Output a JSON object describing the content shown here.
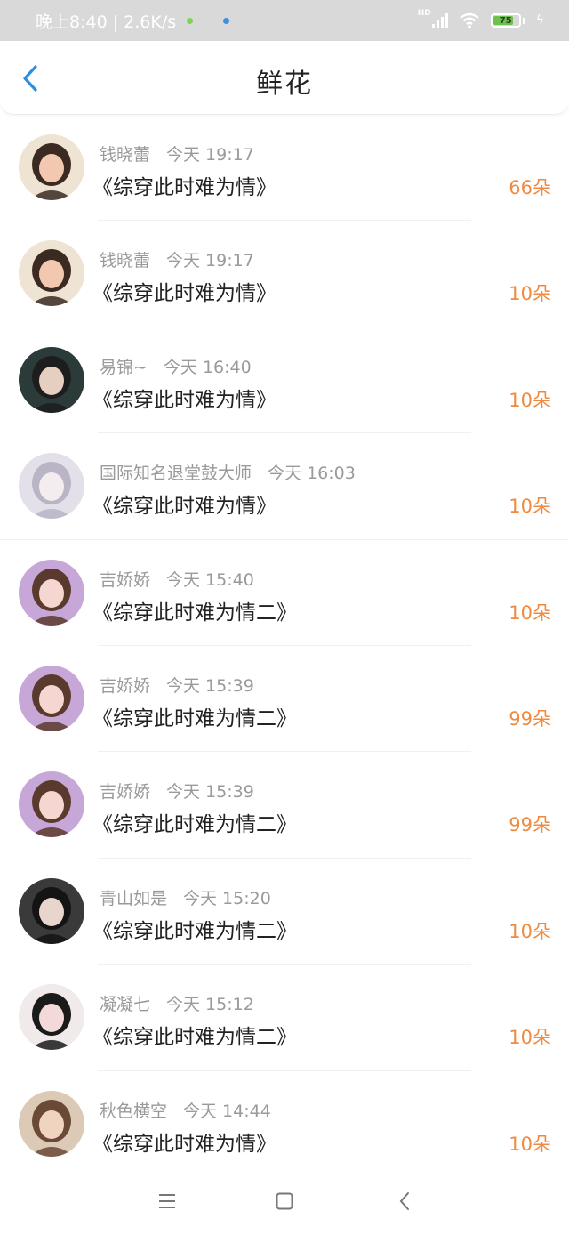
{
  "status_bar": {
    "time_speed": "晚上8:40 | 2.6K/s",
    "hd": "HD",
    "battery": "75",
    "dot_colors": [
      "#7bd35b",
      "#3d8fe0"
    ]
  },
  "nav": {
    "title": "鲜花",
    "back_icon": "chevron-left-icon"
  },
  "colors": {
    "accent": "#2a8de6",
    "count": "#f08a40"
  },
  "rows": [
    {
      "user": "钱晓蕾",
      "time": "今天 19:17",
      "book": "《综穿此时难为情》",
      "count": "66朵"
    },
    {
      "user": "钱晓蕾",
      "time": "今天 19:17",
      "book": "《综穿此时难为情》",
      "count": "10朵"
    },
    {
      "user": "易锦~",
      "time": "今天 16:40",
      "book": "《综穿此时难为情》",
      "count": "10朵"
    },
    {
      "user": "国际知名退堂鼓大师",
      "time": "今天 16:03",
      "book": "《综穿此时难为情》",
      "count": "10朵"
    },
    {
      "user": "吉娇娇",
      "time": "今天 15:40",
      "book": "《综穿此时难为情二》",
      "count": "10朵"
    },
    {
      "user": "吉娇娇",
      "time": "今天 15:39",
      "book": "《综穿此时难为情二》",
      "count": "99朵"
    },
    {
      "user": "吉娇娇",
      "time": "今天 15:39",
      "book": "《综穿此时难为情二》",
      "count": "99朵"
    },
    {
      "user": "青山如是",
      "time": "今天 15:20",
      "book": "《综穿此时难为情二》",
      "count": "10朵"
    },
    {
      "user": "凝凝七",
      "time": "今天 15:12",
      "book": "《综穿此时难为情二》",
      "count": "10朵"
    },
    {
      "user": "秋色横空",
      "time": "今天 14:44",
      "book": "《综穿此时难为情》",
      "count": "10朵"
    }
  ],
  "bottom_nav": {
    "menu_icon": "menu-icon",
    "home_icon": "home-square-icon",
    "back_icon": "back-triangle-icon"
  }
}
